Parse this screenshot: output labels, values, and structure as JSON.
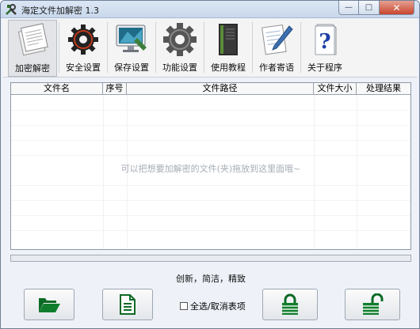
{
  "window": {
    "title": "海定文件加解密 1.3",
    "caption_buttons": {
      "minimize": "—",
      "maximize": "□",
      "close": "✕"
    }
  },
  "toolbar": {
    "items": [
      {
        "label": "加密解密",
        "icon": "documents-icon",
        "active": true
      },
      {
        "label": "安全设置",
        "icon": "gear-dark-icon",
        "active": false
      },
      {
        "label": "保存设置",
        "icon": "monitor-icon",
        "active": false
      },
      {
        "label": "功能设置",
        "icon": "gear-grey-icon",
        "active": false
      },
      {
        "label": "使用教程",
        "icon": "book-icon",
        "active": false
      },
      {
        "label": "作者寄语",
        "icon": "pen-paper-icon",
        "active": false
      },
      {
        "label": "关于程序",
        "icon": "help-icon",
        "active": false
      }
    ]
  },
  "table": {
    "columns": [
      "文件名",
      "序号",
      "文件路径",
      "文件大小",
      "处理结果"
    ],
    "rows": [],
    "drop_hint": "可以把想要加解密的文件(夹)拖放到这里面哦~"
  },
  "progress": {
    "value": 0
  },
  "slogan": "创新，简洁，精致",
  "bottom": {
    "open_icon": "folder-open-icon",
    "doc_icon": "document-icon",
    "select_all_label": "全选/取消表项",
    "lock_icon": "lock-closed-icon",
    "unlock_icon": "lock-open-icon"
  },
  "colors": {
    "accent": "#0d7a2a",
    "title_bar": "#c9d8ec"
  }
}
